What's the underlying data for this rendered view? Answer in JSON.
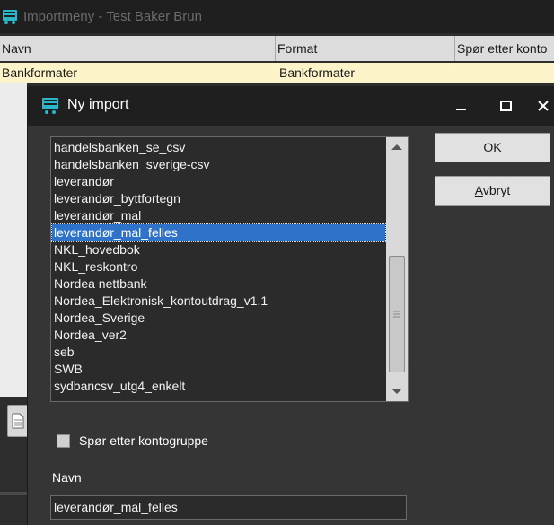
{
  "background_window": {
    "title": "Importmeny - Test Baker Brun",
    "columns": [
      "Navn",
      "Format",
      "Spør etter konto"
    ],
    "rows": [
      {
        "navn": "Bankformater",
        "format": "Bankformater"
      }
    ]
  },
  "dialog": {
    "title": "Ny import",
    "list_items": [
      "handelsbanken_se_csv",
      "handelsbanken_sverige-csv",
      "leverandør",
      "leverandør_byttfortegn",
      "leverandør_mal",
      "leverandør_mal_felles",
      "NKL_hovedbok",
      "NKL_reskontro",
      "Nordea nettbank",
      "Nordea_Elektronisk_kontoutdrag_v1.1",
      "Nordea_Sverige",
      "Nordea_ver2",
      "seb",
      "SWB",
      "sydbancsv_utg4_enkelt"
    ],
    "selected_item": "leverandør_mal_felles",
    "ok_button": {
      "accel": "O",
      "rest": "K"
    },
    "cancel_button": {
      "accel": "A",
      "rest": "vbryt"
    },
    "checkbox_label": "Spør etter kontogruppe",
    "checkbox_checked": false,
    "name_label": "Navn",
    "name_value": "leverandør_mal_felles"
  },
  "colors": {
    "selection": "#2f72c9",
    "app_icon": "#2bb7c9",
    "highlight_row": "#fdf3c8"
  },
  "icons": [
    "app-icon",
    "minimize-icon",
    "maximize-icon",
    "close-icon",
    "scroll-up-icon",
    "scroll-down-icon",
    "document-icon"
  ]
}
